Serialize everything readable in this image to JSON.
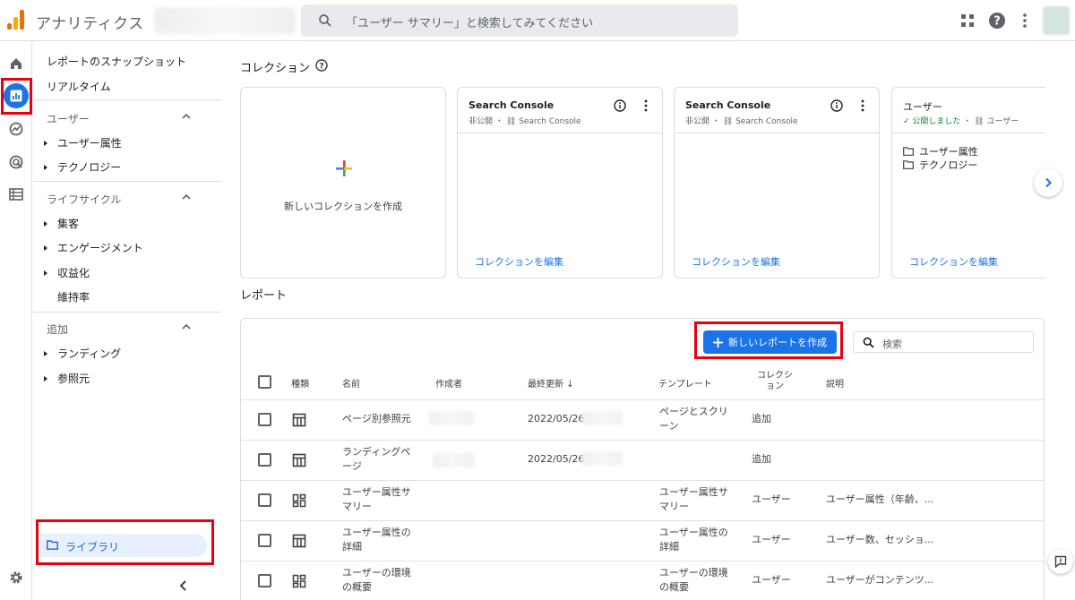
{
  "app": {
    "title": "アナリティクス"
  },
  "search": {
    "placeholder": "「ユーザー サマリー」と検索してみてください"
  },
  "icons": {
    "apps": "apps-grid-icon",
    "help": "help-icon",
    "more": "more-vert-icon"
  },
  "sidebar": {
    "top_links": [
      "レポートのスナップショット",
      "リアルタイム"
    ],
    "sections": [
      {
        "title": "ユーザー",
        "items": [
          "ユーザー属性",
          "テクノロジー"
        ]
      },
      {
        "title": "ライフサイクル",
        "items": [
          "集客",
          "エンゲージメント",
          "収益化"
        ],
        "plain_items": [
          "維持率"
        ]
      },
      {
        "title": "追加",
        "items": [
          "ランディング",
          "参照元"
        ]
      }
    ],
    "library_label": "ライブラリ"
  },
  "collections": {
    "title": "コレクション",
    "new_label": "新しいコレクションを作成",
    "cards": [
      {
        "title": "Search Console",
        "status": "非公開",
        "source": "Search Console",
        "edit": "コレクションを編集"
      },
      {
        "title": "Search Console",
        "status": "非公開",
        "source": "Search Console",
        "edit": "コレクションを編集"
      },
      {
        "title": "ユーザー",
        "status": "公開しました",
        "source": "ユーザー",
        "items": [
          "ユーザー属性",
          "テクノロジー"
        ],
        "edit": "コレクションを編集"
      }
    ]
  },
  "reports": {
    "title": "レポート",
    "create_button": "新しいレポートを作成",
    "search_placeholder": "検索",
    "headers": {
      "type": "種類",
      "name": "名前",
      "author": "作成者",
      "updated": "最終更新",
      "template": "テンプレート",
      "collection": "コレクション",
      "description": "説明"
    },
    "rows": [
      {
        "type": "table",
        "name": "ページ別参照元",
        "updated": "2022/05/26",
        "template": "ページとスクリーン",
        "collection": "追加",
        "description": ""
      },
      {
        "type": "table",
        "name": "ランディングページ",
        "updated": "2022/05/26",
        "template": "",
        "collection": "追加",
        "description": ""
      },
      {
        "type": "dashboard",
        "name": "ユーザー属性サマリー",
        "updated": "",
        "template": "ユーザー属性サマリー",
        "collection": "ユーザー",
        "description": "ユーザー属性（年齢、..."
      },
      {
        "type": "table",
        "name": "ユーザー属性の詳細",
        "updated": "",
        "template": "ユーザー属性の詳細",
        "collection": "ユーザー",
        "description": "ユーザー数、セッショ..."
      },
      {
        "type": "dashboard",
        "name": "ユーザーの環境の概要",
        "updated": "",
        "template": "ユーザーの環境の概要",
        "collection": "ユーザー",
        "description": "ユーザーがコンテンツ..."
      }
    ]
  },
  "colors": {
    "accent": "#1a73e8",
    "highlight": "#e60012",
    "border": "#dadce0"
  }
}
